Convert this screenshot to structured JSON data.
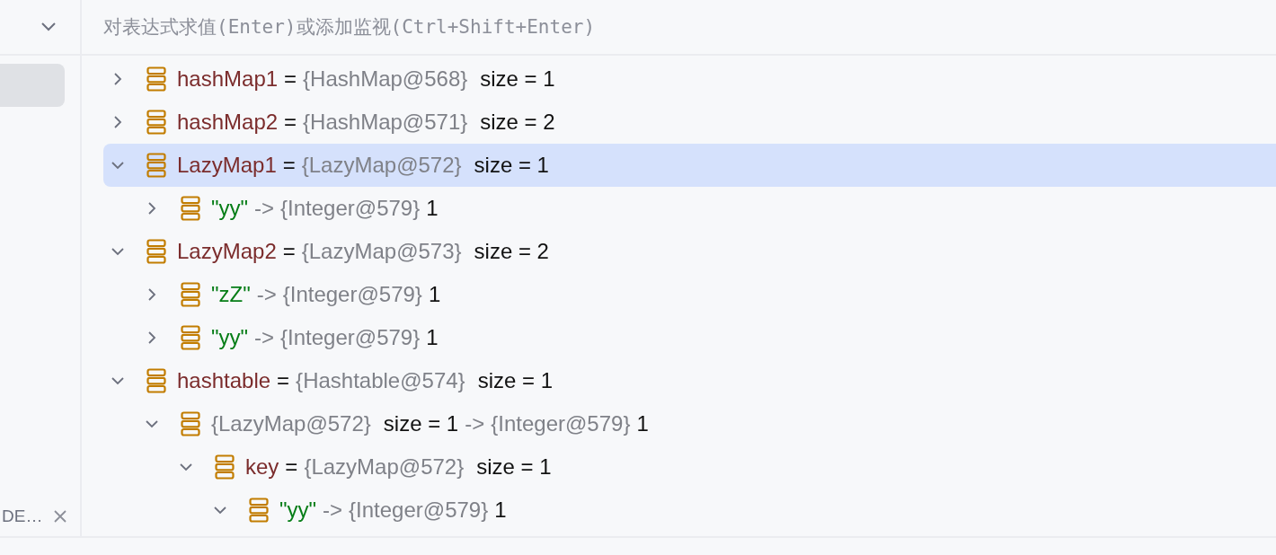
{
  "left_panel": {
    "items": [
      {
        "selected": true
      }
    ],
    "tab": {
      "label": "DE…"
    }
  },
  "evaluate_field": {
    "placeholder": "对表达式求值(Enter)或添加监视(Ctrl+Shift+Enter)"
  },
  "variables": [
    {
      "expanded": false,
      "selected": false,
      "parts": [
        {
          "kind": "name",
          "text": "hashMap1"
        },
        {
          "kind": "plain",
          "text": "="
        },
        {
          "kind": "ref",
          "text": "{HashMap@568}"
        },
        {
          "kind": "size",
          "text": "size = 1"
        }
      ]
    },
    {
      "expanded": false,
      "selected": false,
      "parts": [
        {
          "kind": "name",
          "text": "hashMap2"
        },
        {
          "kind": "plain",
          "text": "="
        },
        {
          "kind": "ref",
          "text": "{HashMap@571}"
        },
        {
          "kind": "size",
          "text": "size = 2"
        }
      ]
    },
    {
      "expanded": true,
      "selected": true,
      "parts": [
        {
          "kind": "name",
          "text": "LazyMap1"
        },
        {
          "kind": "plain",
          "text": "="
        },
        {
          "kind": "ref",
          "text": "{LazyMap@572}"
        },
        {
          "kind": "size",
          "text": "size = 1"
        }
      ],
      "children": [
        {
          "expanded": false,
          "selected": false,
          "parts": [
            {
              "kind": "string",
              "text": "\"yy\""
            },
            {
              "kind": "ref",
              "text": "->"
            },
            {
              "kind": "ref",
              "text": "{Integer@579}"
            },
            {
              "kind": "plain",
              "text": "1"
            }
          ]
        }
      ]
    },
    {
      "expanded": true,
      "selected": false,
      "parts": [
        {
          "kind": "name",
          "text": "LazyMap2"
        },
        {
          "kind": "plain",
          "text": "="
        },
        {
          "kind": "ref",
          "text": "{LazyMap@573}"
        },
        {
          "kind": "size",
          "text": "size = 2"
        }
      ],
      "children": [
        {
          "expanded": false,
          "selected": false,
          "parts": [
            {
              "kind": "string",
              "text": "\"zZ\""
            },
            {
              "kind": "ref",
              "text": "->"
            },
            {
              "kind": "ref",
              "text": "{Integer@579}"
            },
            {
              "kind": "plain",
              "text": "1"
            }
          ]
        },
        {
          "expanded": false,
          "selected": false,
          "parts": [
            {
              "kind": "string",
              "text": "\"yy\""
            },
            {
              "kind": "ref",
              "text": "->"
            },
            {
              "kind": "ref",
              "text": "{Integer@579}"
            },
            {
              "kind": "plain",
              "text": "1"
            }
          ]
        }
      ]
    },
    {
      "expanded": true,
      "selected": false,
      "parts": [
        {
          "kind": "name",
          "text": "hashtable"
        },
        {
          "kind": "plain",
          "text": "="
        },
        {
          "kind": "ref",
          "text": "{Hashtable@574}"
        },
        {
          "kind": "size",
          "text": "size = 1"
        }
      ],
      "children": [
        {
          "expanded": true,
          "selected": false,
          "parts": [
            {
              "kind": "ref",
              "text": "{LazyMap@572}"
            },
            {
              "kind": "size",
              "text": "size = 1"
            },
            {
              "kind": "ref",
              "text": "->"
            },
            {
              "kind": "ref",
              "text": "{Integer@579}"
            },
            {
              "kind": "plain",
              "text": "1"
            }
          ],
          "children": [
            {
              "expanded": true,
              "selected": false,
              "parts": [
                {
                  "kind": "name",
                  "text": "key"
                },
                {
                  "kind": "plain",
                  "text": "="
                },
                {
                  "kind": "ref",
                  "text": "{LazyMap@572}"
                },
                {
                  "kind": "size",
                  "text": "size = 1"
                }
              ],
              "children": [
                {
                  "expanded": true,
                  "selected": false,
                  "parts": [
                    {
                      "kind": "string",
                      "text": "\"yy\""
                    },
                    {
                      "kind": "ref",
                      "text": "->"
                    },
                    {
                      "kind": "ref",
                      "text": "{Integer@579}"
                    },
                    {
                      "kind": "plain",
                      "text": "1"
                    }
                  ]
                }
              ]
            }
          ]
        }
      ]
    }
  ]
}
